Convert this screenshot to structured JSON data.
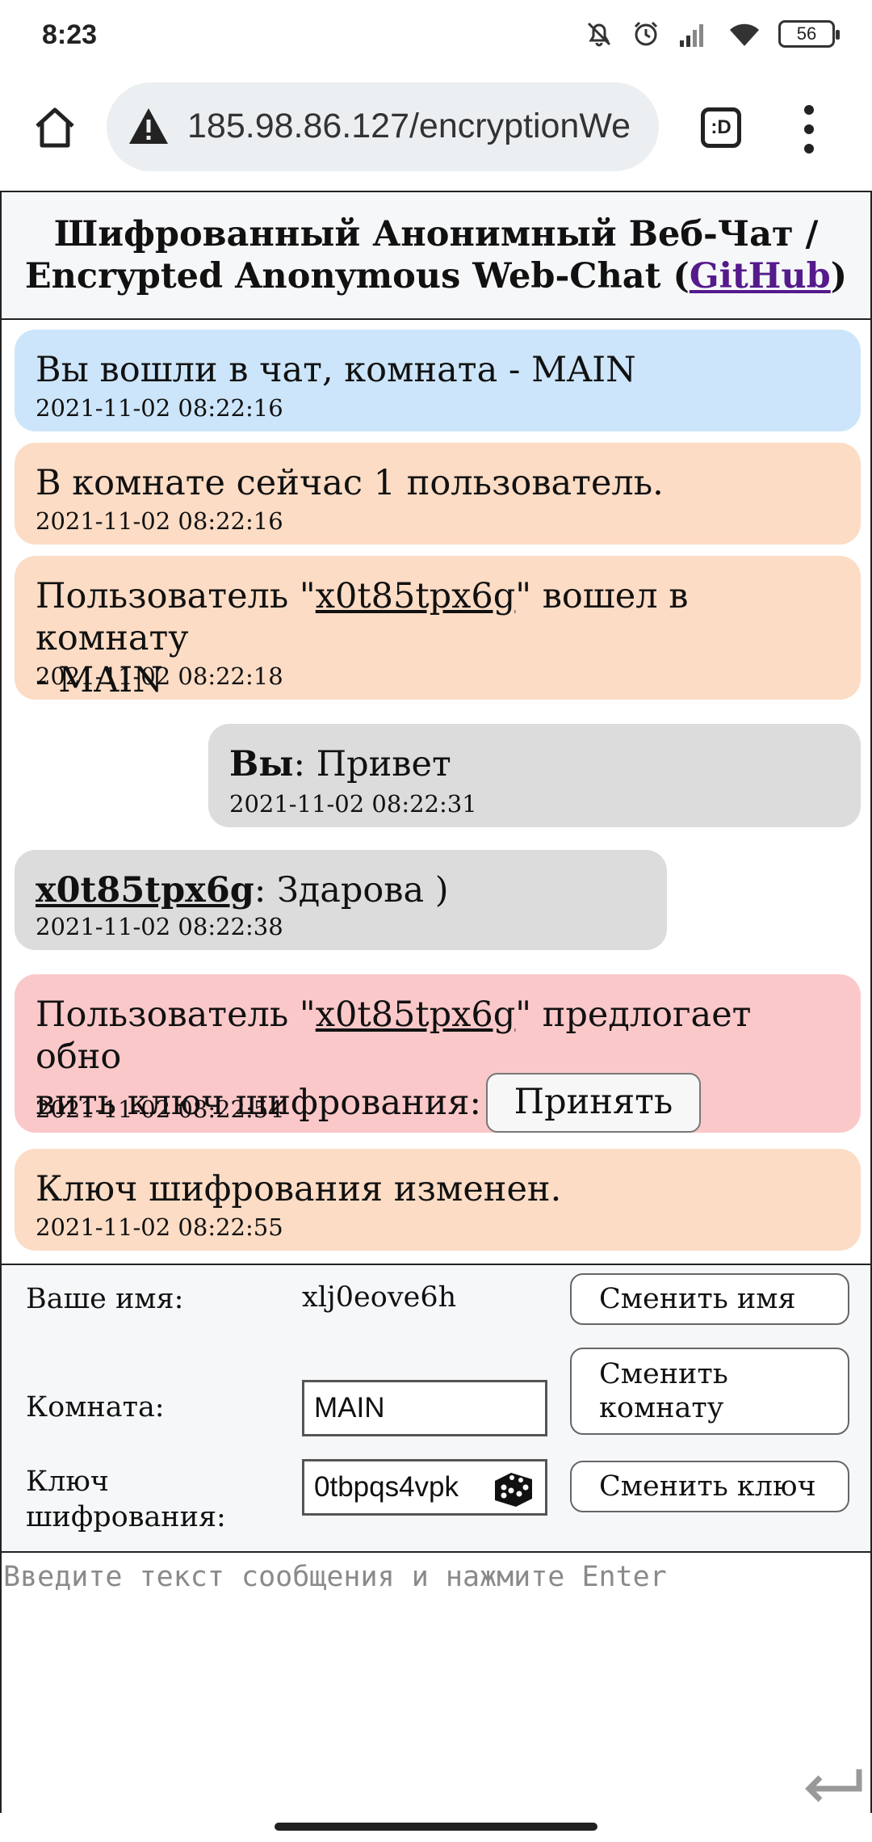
{
  "status_bar": {
    "time": "8:23",
    "battery": "56"
  },
  "browser": {
    "url": "185.98.86.127/encryptionWe",
    "tab_icon": ":D"
  },
  "header": {
    "title_ru": "Шифрованный Анонимный Веб-Чат /",
    "title_en": "Encrypted Anonymous Web-Chat (",
    "github": "GitHub",
    "title_end": ")"
  },
  "messages": [
    {
      "text": "Вы вошли в чат, комната - MAIN",
      "time": "2021-11-02 08:22:16"
    },
    {
      "text": "В комнате сейчас 1 пользователь.",
      "time": "2021-11-02 08:22:16"
    },
    {
      "before": "Пользователь \"",
      "nick": "x0t85tpx6g",
      "after": "\" вошел в комнату",
      "line2": "- MAIN",
      "time": "2021-11-02 08:22:18"
    },
    {
      "author": "Вы",
      "text": ": Привет",
      "time": "2021-11-02 08:22:31"
    },
    {
      "author": "x0t85tpx6g",
      "text": ": Здарова )",
      "time": "2021-11-02 08:22:38"
    },
    {
      "before": "Пользователь \"",
      "nick": "x0t85tpx6g",
      "after": "\" предлогает обно",
      "line2": "вить ключ шифрования:",
      "button": "Принять",
      "time": "2021-11-02 08:22:54"
    },
    {
      "text": "Ключ шифрования изменен.",
      "time": "2021-11-02 08:22:55"
    }
  ],
  "controls": {
    "name_label": "Ваше имя:",
    "name_value": "xlj0eove6h",
    "change_name": "Сменить имя",
    "room_label": "Комната:",
    "room_value": "MAIN",
    "change_room": "Сменить комнату",
    "key_label": "Ключ шифрования:",
    "key_value": "0tbpqs4vpk",
    "change_key": "Сменить ключ"
  },
  "composer": {
    "placeholder": "Введите текст сообщения и нажмите Enter"
  },
  "colors": {
    "system_info": "#cce5fa",
    "event": "#fcdcc5",
    "chat": "#dcdcdc",
    "key_request": "#fbc8c9",
    "link": "#551a8b"
  }
}
